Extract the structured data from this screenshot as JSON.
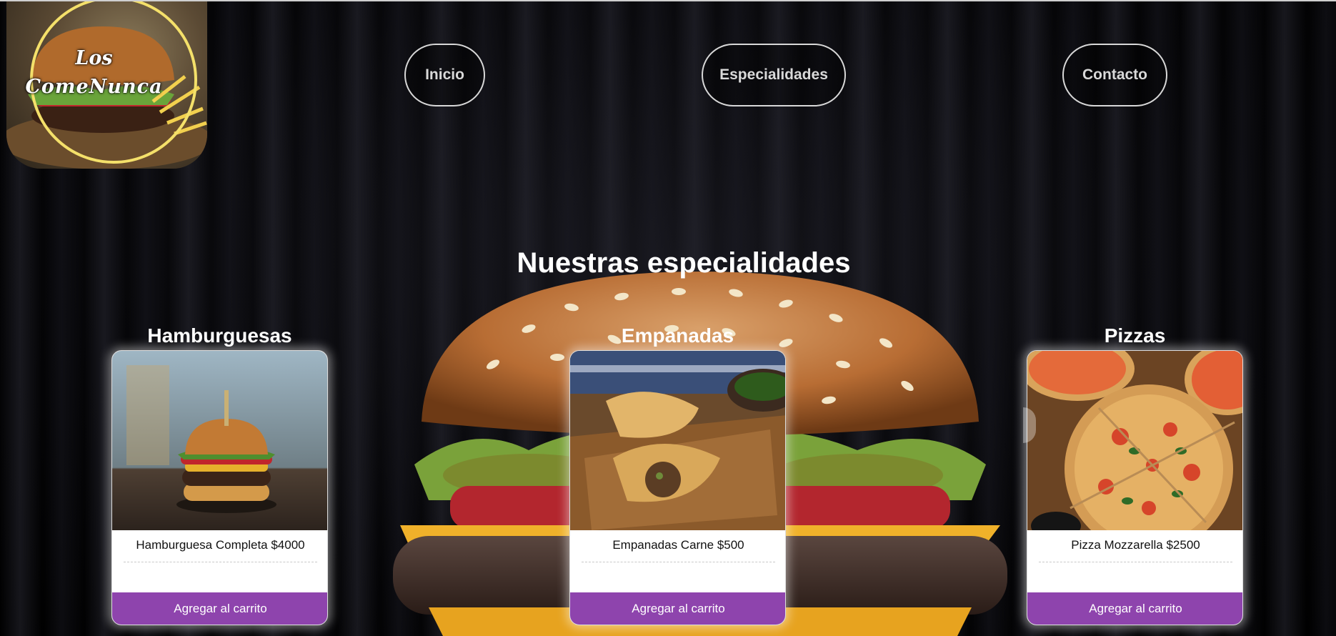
{
  "brand": {
    "logo_line1": "Los",
    "logo_line2": "ComeNunca",
    "logo_icon": "burger-logo"
  },
  "nav": {
    "items": [
      {
        "label": "Inicio"
      },
      {
        "label": "Especialidades"
      },
      {
        "label": "Contacto"
      }
    ]
  },
  "specialties": {
    "title": "Nuestras especialidades",
    "categories": [
      {
        "title": "Hamburguesas",
        "product": "Hamburguesa Completa $4000",
        "button": "Agregar al carrito",
        "image_icon": "burger-photo"
      },
      {
        "title": "Empanadas",
        "product": "Empanadas Carne $500",
        "button": "Agregar al carrito",
        "image_icon": "empanadas-photo"
      },
      {
        "title": "Pizzas",
        "product": "Pizza Mozzarella $2500",
        "button": "Agregar al carrito",
        "image_icon": "pizza-photo"
      }
    ]
  },
  "colors": {
    "accent": "#8e44ad",
    "background": "#000000",
    "card": "#ffffff",
    "logo_ring": "#f4e06a"
  }
}
